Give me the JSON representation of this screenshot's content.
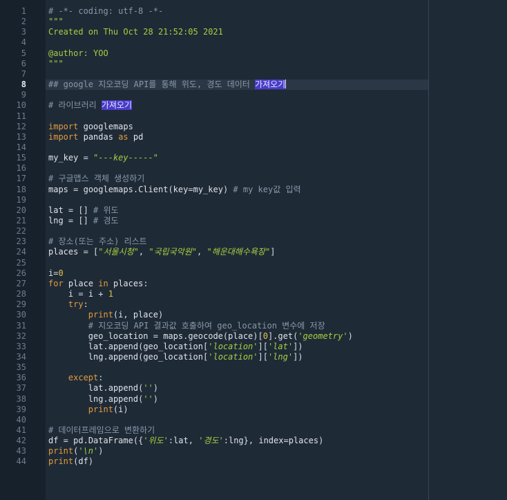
{
  "editor": {
    "current_line": 8,
    "lines": [
      {
        "n": "1",
        "t": "# -*- coding: utf-8 -*-"
      },
      {
        "n": "2",
        "t": "\"\"\""
      },
      {
        "n": "3",
        "t": "Created on Thu Oct 28 21:52:05 2021"
      },
      {
        "n": "4",
        "t": ""
      },
      {
        "n": "5",
        "t": "@author: YOO"
      },
      {
        "n": "6",
        "t": "\"\"\""
      },
      {
        "n": "7",
        "t": ""
      },
      {
        "n": "8",
        "t": "## google 지오코딩 API를 통해 위도, 경도 데이터 가져오기"
      },
      {
        "n": "9",
        "t": ""
      },
      {
        "n": "10",
        "t": "# 라이브러리 가져오기"
      },
      {
        "n": "11",
        "t": ""
      },
      {
        "n": "12",
        "t": "import googlemaps"
      },
      {
        "n": "13",
        "t": "import pandas as pd"
      },
      {
        "n": "14",
        "t": ""
      },
      {
        "n": "15",
        "t": "my_key = \"---key-----\""
      },
      {
        "n": "16",
        "t": ""
      },
      {
        "n": "17",
        "t": "# 구글맵스 객체 생성하기"
      },
      {
        "n": "18",
        "t": "maps = googlemaps.Client(key=my_key) # my key값 입력"
      },
      {
        "n": "19",
        "t": ""
      },
      {
        "n": "20",
        "t": "lat = [] # 위도"
      },
      {
        "n": "21",
        "t": "lng = [] # 경도"
      },
      {
        "n": "22",
        "t": ""
      },
      {
        "n": "23",
        "t": "# 장소(또는 주소) 리스트"
      },
      {
        "n": "24",
        "t": "places = [\"서울시청\", \"국립국악원\", \"해운대해수욕장\"]"
      },
      {
        "n": "25",
        "t": ""
      },
      {
        "n": "26",
        "t": "i=0"
      },
      {
        "n": "27",
        "t": "for place in places:"
      },
      {
        "n": "28",
        "t": "    i = i + 1"
      },
      {
        "n": "29",
        "t": "    try:"
      },
      {
        "n": "30",
        "t": "        print(i, place)"
      },
      {
        "n": "31",
        "t": "        # 지오코딩 API 결과값 호출하여 geo_location 변수에 저장"
      },
      {
        "n": "32",
        "t": "        geo_location = maps.geocode(place)[0].get('geometry')"
      },
      {
        "n": "33",
        "t": "        lat.append(geo_location['location']['lat'])"
      },
      {
        "n": "34",
        "t": "        lng.append(geo_location['location']['lng'])"
      },
      {
        "n": "35",
        "t": ""
      },
      {
        "n": "36",
        "t": "    except:"
      },
      {
        "n": "37",
        "t": "        lat.append('')"
      },
      {
        "n": "38",
        "t": "        lng.append('')"
      },
      {
        "n": "39",
        "t": "        print(i)"
      },
      {
        "n": "40",
        "t": ""
      },
      {
        "n": "41",
        "t": "# 데이터프레임으로 변환하기"
      },
      {
        "n": "42",
        "t": "df = pd.DataFrame({'위도':lat, '경도':lng}, index=places)"
      },
      {
        "n": "43",
        "t": "print('\\n')"
      },
      {
        "n": "44",
        "t": "print(df)"
      }
    ]
  }
}
